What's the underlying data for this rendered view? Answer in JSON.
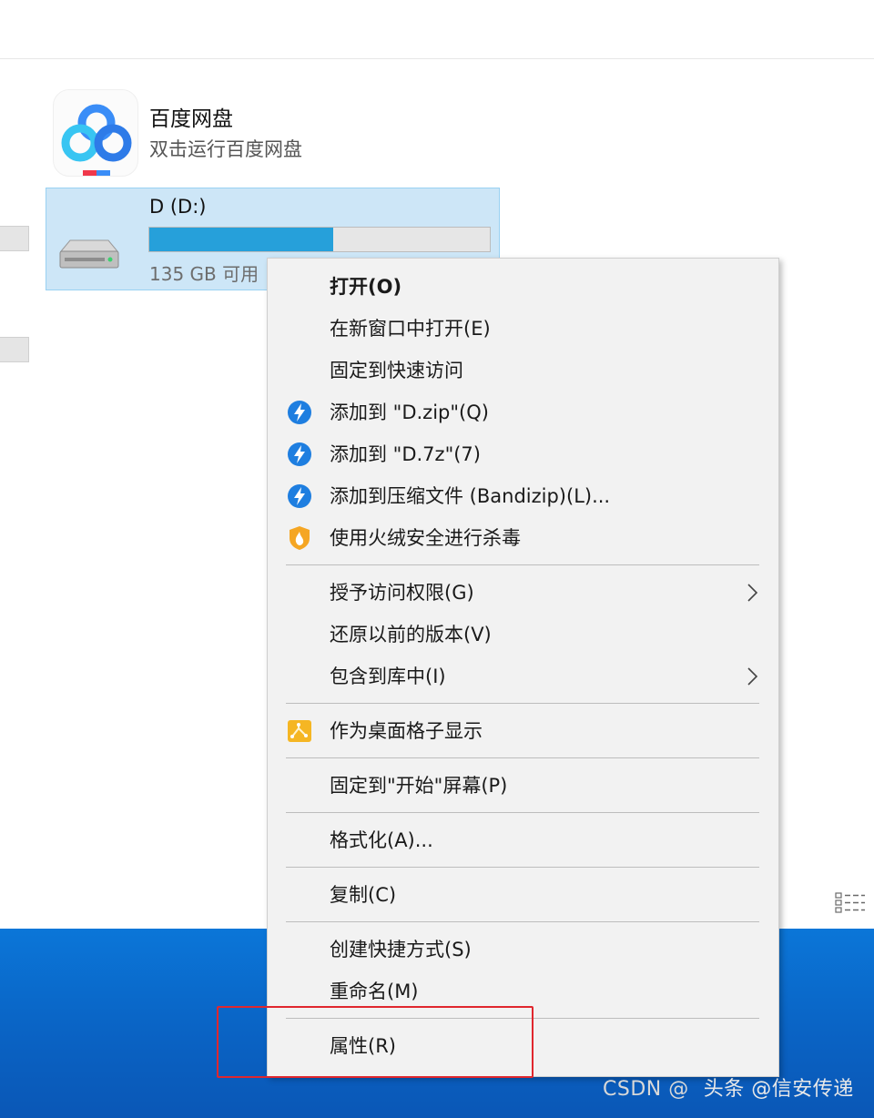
{
  "app": {
    "name": "百度网盘",
    "subtitle": "双击运行百度网盘",
    "icon": "baidu-netdisk-icon"
  },
  "drive": {
    "name": "D (D:)",
    "free_text": "135 GB 可用",
    "usage_fraction": 0.54,
    "bar_color": "#26a0da",
    "icon": "hard-drive-icon"
  },
  "context_menu": {
    "items": [
      {
        "label": "打开(O)",
        "bold": true
      },
      {
        "label": "在新窗口中打开(E)"
      },
      {
        "label": "固定到快速访问"
      },
      {
        "label": "添加到 \"D.zip\"(Q)",
        "icon": "bandizip-icon"
      },
      {
        "label": "添加到 \"D.7z\"(7)",
        "icon": "bandizip-icon"
      },
      {
        "label": "添加到压缩文件 (Bandizip)(L)...",
        "icon": "bandizip-icon"
      },
      {
        "label": "使用火绒安全进行杀毒",
        "icon": "huorong-shield-icon"
      },
      {
        "label": "授予访问权限(G)",
        "submenu": true
      },
      {
        "label": "还原以前的版本(V)"
      },
      {
        "label": "包含到库中(I)",
        "submenu": true
      },
      {
        "label": "作为桌面格子显示",
        "icon": "desktop-grid-icon"
      },
      {
        "label": "固定到\"开始\"屏幕(P)"
      },
      {
        "label": "格式化(A)..."
      },
      {
        "label": "复制(C)"
      },
      {
        "label": "创建快捷方式(S)"
      },
      {
        "label": "重命名(M)"
      },
      {
        "label": "属性(R)",
        "highlighted": true
      }
    ]
  },
  "watermark": {
    "csdn": "CSDN @",
    "text": "头条 @信安传递"
  },
  "colors": {
    "menu_background": "#f2f2f2",
    "selection": "#cde6f7",
    "highlight_border": "#e0272e",
    "desktop_blue": "#0b76d8"
  }
}
